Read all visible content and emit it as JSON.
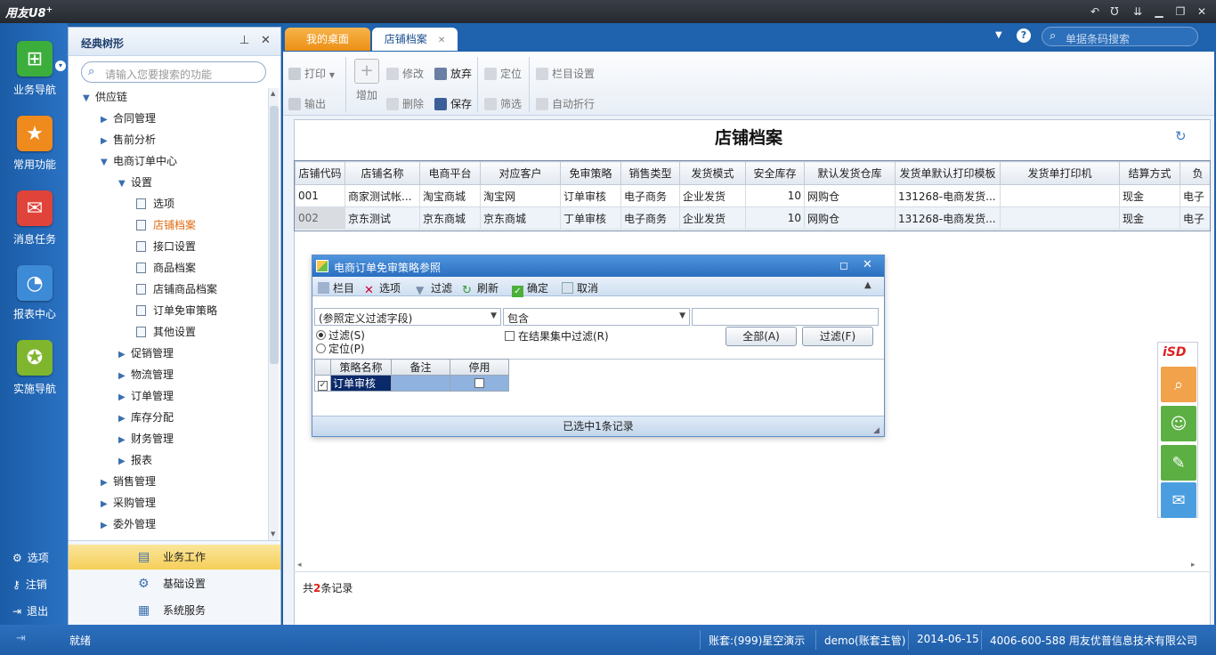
{
  "app": {
    "logo": "用友U8",
    "logo_sup": "+"
  },
  "leftnav": [
    {
      "label": "业务导航",
      "icon": "tree-icon",
      "color": "#3cae3c"
    },
    {
      "label": "常用功能",
      "icon": "star-icon",
      "color": "#ef8a1c"
    },
    {
      "label": "消息任务",
      "icon": "mail-icon",
      "color": "#e0433a"
    },
    {
      "label": "报表中心",
      "icon": "chart-icon",
      "color": "#3d8ad6"
    },
    {
      "label": "实施导航",
      "icon": "compass-icon",
      "color": "#7fb62e"
    }
  ],
  "leftbottom": {
    "options": "选项",
    "logout": "注销",
    "exit": "退出"
  },
  "tree": {
    "title": "经典树形",
    "search_placeholder": "请输入您要搜索的功能",
    "items": [
      {
        "label": "供应链",
        "level": 0,
        "type": "open"
      },
      {
        "label": "合同管理",
        "level": 1,
        "type": "closed"
      },
      {
        "label": "售前分析",
        "level": 1,
        "type": "closed"
      },
      {
        "label": "电商订单中心",
        "level": 1,
        "type": "open"
      },
      {
        "label": "设置",
        "level": 2,
        "type": "open"
      },
      {
        "label": "选项",
        "level": 3,
        "type": "leaf"
      },
      {
        "label": "店铺档案",
        "level": 3,
        "type": "leaf",
        "active": true
      },
      {
        "label": "接口设置",
        "level": 3,
        "type": "leaf"
      },
      {
        "label": "商品档案",
        "level": 3,
        "type": "leaf"
      },
      {
        "label": "店铺商品档案",
        "level": 3,
        "type": "leaf"
      },
      {
        "label": "订单免审策略",
        "level": 3,
        "type": "leaf"
      },
      {
        "label": "其他设置",
        "level": 3,
        "type": "leaf"
      },
      {
        "label": "促销管理",
        "level": 2,
        "type": "closed"
      },
      {
        "label": "物流管理",
        "level": 2,
        "type": "closed"
      },
      {
        "label": "订单管理",
        "level": 2,
        "type": "closed"
      },
      {
        "label": "库存分配",
        "level": 2,
        "type": "closed"
      },
      {
        "label": "财务管理",
        "level": 2,
        "type": "closed"
      },
      {
        "label": "报表",
        "level": 2,
        "type": "closed"
      },
      {
        "label": "销售管理",
        "level": 1,
        "type": "closed"
      },
      {
        "label": "采购管理",
        "level": 1,
        "type": "closed"
      },
      {
        "label": "委外管理",
        "level": 1,
        "type": "closed"
      }
    ],
    "footer": [
      "业务工作",
      "基础设置",
      "系统服务"
    ]
  },
  "tabs": [
    "我的桌面",
    "店铺档案"
  ],
  "topsearch_placeholder": "单据条码搜索",
  "toolbar": {
    "print": "打印",
    "export": "输出",
    "add": "增加",
    "edit": "修改",
    "delete": "删除",
    "abandon": "放弃",
    "save": "保存",
    "locate": "定位",
    "filter": "筛选",
    "colset": "栏目设置",
    "autowrap": "自动折行"
  },
  "page_title": "店铺档案",
  "grid": {
    "headers": [
      "店铺代码",
      "店铺名称",
      "电商平台",
      "对应客户",
      "免审策略",
      "销售类型",
      "发货模式",
      "安全库存",
      "默认发货仓库",
      "发货单默认打印模板",
      "发货单打印机",
      "结算方式",
      "负"
    ],
    "rows": [
      [
        "001",
        "商家测试帐...",
        "淘宝商城",
        "淘宝网",
        "订单审核",
        "电子商务",
        "企业发货",
        "10",
        "网购仓",
        "131268-电商发货...",
        "",
        "现金",
        "电子"
      ],
      [
        "002",
        "京东测试",
        "京东商城",
        "京东商城",
        "丁单审核",
        "电子商务",
        "企业发货",
        "10",
        "网购仓",
        "131268-电商发货...",
        "",
        "现金",
        "电子"
      ]
    ],
    "record_prefix": "共",
    "record_count": "2",
    "record_suffix": "条记录"
  },
  "dialog": {
    "title": "电商订单免审策略参照",
    "tools": [
      "栏目",
      "选项",
      "过滤",
      "刷新",
      "确定",
      "取消"
    ],
    "field_select": "(参照定义过滤字段)",
    "op_select": "包含",
    "value": "",
    "radio_filter": "过滤(S)",
    "radio_locate": "定位(P)",
    "in_result": "在结果集中过滤(R)",
    "btn_all": "全部(A)",
    "btn_filter": "过滤(F)",
    "headers": [
      "策略名称",
      "备注",
      "停用"
    ],
    "rows": [
      {
        "name": "订单审核",
        "note": "",
        "disabled": false,
        "checked": true
      }
    ],
    "status": "已选中1条记录"
  },
  "footer": {
    "status": "就绪",
    "account": "账套:(999)星空演示",
    "user": "demo(账套主管)",
    "date": "2014-06-15",
    "company": "4006-600-588 用友优普信息技术有限公司"
  }
}
